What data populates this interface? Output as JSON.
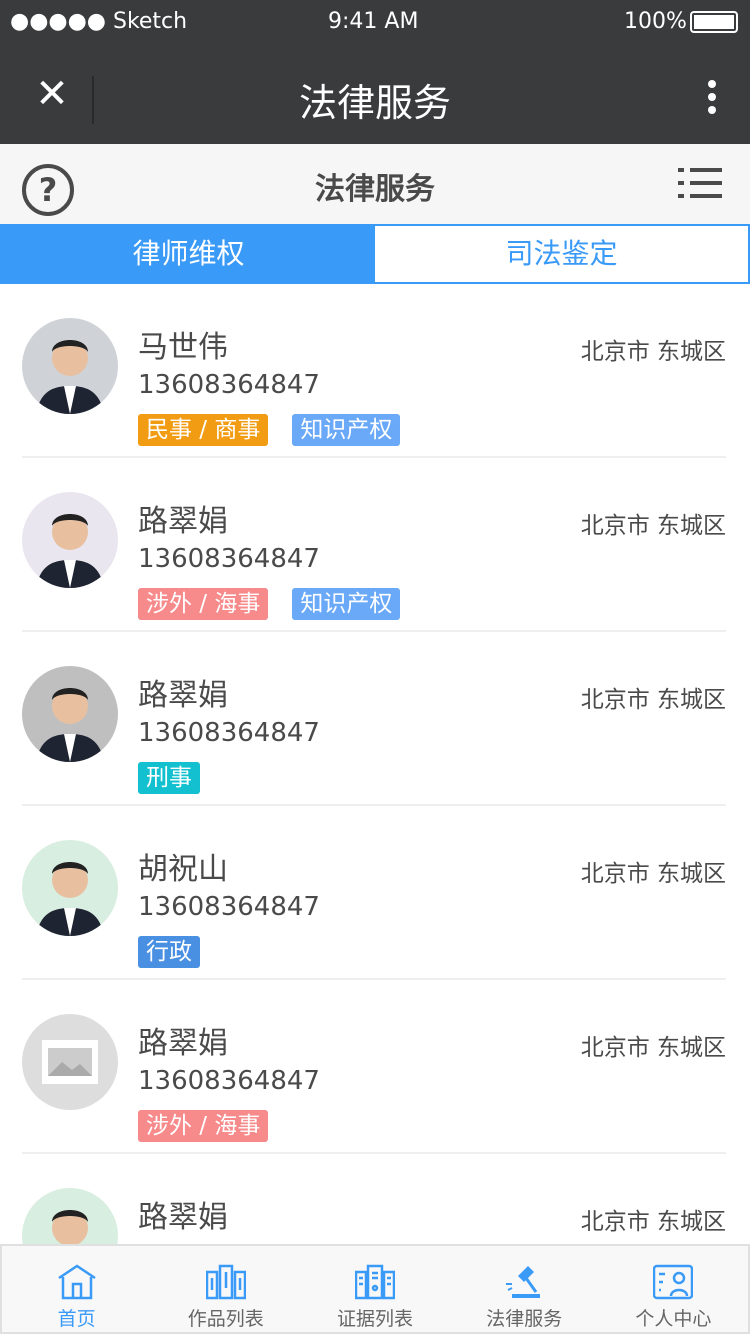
{
  "status": {
    "carrier": "●●●●● Sketch",
    "time": "9:41 AM",
    "battery": "100%"
  },
  "nav": {
    "title": "法律服务",
    "close": "✕"
  },
  "sub": {
    "title": "法律服务",
    "help": "?"
  },
  "tabs": [
    {
      "label": "律师维权",
      "active": true
    },
    {
      "label": "司法鉴定",
      "active": false
    }
  ],
  "lawyers": [
    {
      "name": "马世伟",
      "phone": "13608364847",
      "location": "北京市 东城区",
      "tags": [
        {
          "label": "民事 / 商事",
          "color": "#F29C14"
        },
        {
          "label": "知识产权",
          "color": "#6AA8F8"
        }
      ],
      "avatar": "#cfd3d8"
    },
    {
      "name": "路翠娟",
      "phone": "13608364847",
      "location": "北京市 东城区",
      "tags": [
        {
          "label": "涉外 / 海事",
          "color": "#F78A8A"
        },
        {
          "label": "知识产权",
          "color": "#6AA8F8"
        }
      ],
      "avatar": "#e9e6ef"
    },
    {
      "name": "路翠娟",
      "phone": "13608364847",
      "location": "北京市 东城区",
      "tags": [
        {
          "label": "刑事",
          "color": "#12C0CF"
        }
      ],
      "avatar": "#bfbfbf"
    },
    {
      "name": "胡祝山",
      "phone": "13608364847",
      "location": "北京市 东城区",
      "tags": [
        {
          "label": "行政",
          "color": "#4A90E2"
        }
      ],
      "avatar": "#d8eee0"
    },
    {
      "name": "路翠娟",
      "phone": "13608364847",
      "location": "北京市 东城区",
      "tags": [
        {
          "label": "涉外 / 海事",
          "color": "#F78A8A"
        }
      ],
      "avatar": "placeholder"
    },
    {
      "name": "路翠娟",
      "phone": "",
      "location": "北京市 东城区",
      "tags": [],
      "avatar": "#d8eee0"
    }
  ],
  "tabbar": [
    {
      "label": "首页",
      "icon": "home-icon",
      "active": true
    },
    {
      "label": "作品列表",
      "icon": "books-icon"
    },
    {
      "label": "证据列表",
      "icon": "building-icon"
    },
    {
      "label": "法律服务",
      "icon": "gavel-icon"
    },
    {
      "label": "个人中心",
      "icon": "profile-card-icon"
    }
  ]
}
